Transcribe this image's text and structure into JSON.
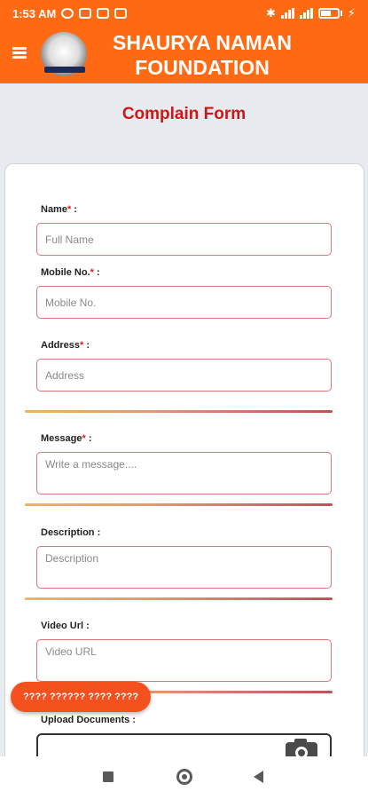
{
  "status_bar": {
    "time": "1:53 AM",
    "battery": "49"
  },
  "app_bar": {
    "title_line1": "SHAURYA NAMAN",
    "title_line2": "FOUNDATION"
  },
  "page": {
    "title": "Complain Form"
  },
  "form": {
    "name": {
      "label": "Name",
      "required_mark": "*",
      "suffix": " :",
      "placeholder": "Full Name"
    },
    "mobile": {
      "label": "Mobile No.",
      "required_mark": "*",
      "suffix": " :",
      "placeholder": "Mobile No."
    },
    "address": {
      "label": "Address",
      "required_mark": "*",
      "suffix": " :",
      "placeholder": "Address"
    },
    "message": {
      "label": "Message",
      "required_mark": "*",
      "suffix": " :",
      "placeholder": "Write a message...."
    },
    "description": {
      "label": "Description :",
      "placeholder": "Description"
    },
    "video_url": {
      "label": "Video Url :",
      "placeholder": "Video URL"
    },
    "upload": {
      "label": "Upload Documents :"
    }
  },
  "floating_button": {
    "label": "???? ?????? ???? ????"
  },
  "colors": {
    "brand_orange": "#ff6a13",
    "title_red": "#d01616",
    "field_border": "#e07474",
    "floating_button": "#f4511e"
  },
  "icons": [
    "menu-icon",
    "logo",
    "camera-icon",
    "nav-recents-icon",
    "nav-home-icon",
    "nav-back-icon"
  ]
}
